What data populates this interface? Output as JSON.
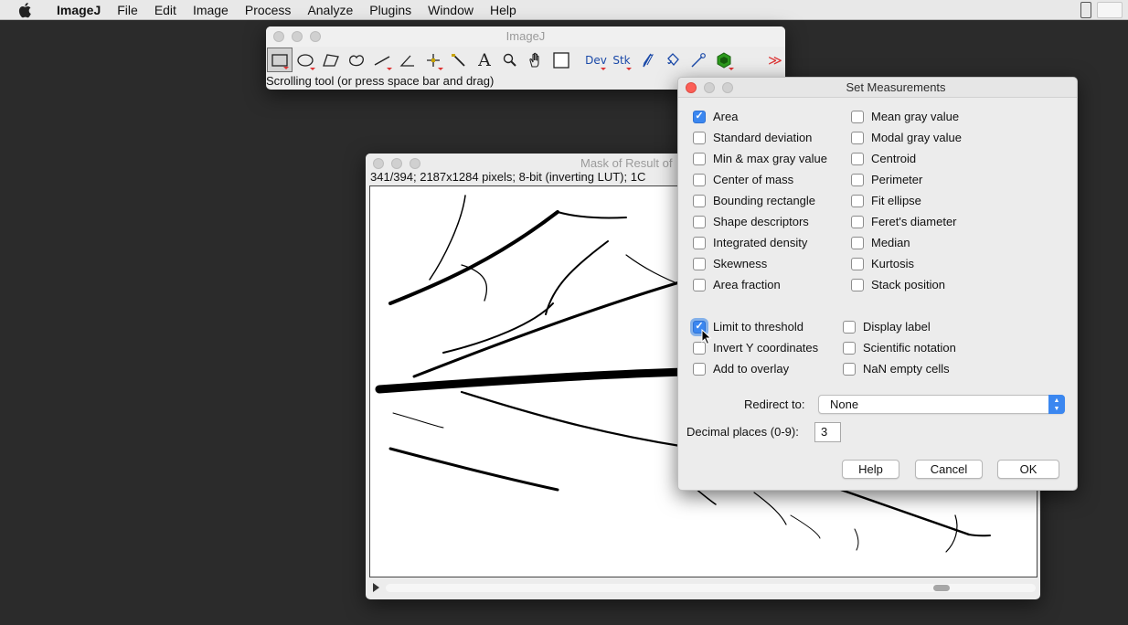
{
  "menubar": {
    "app": "ImageJ",
    "items": [
      "File",
      "Edit",
      "Image",
      "Process",
      "Analyze",
      "Plugins",
      "Window",
      "Help"
    ]
  },
  "imagej_window": {
    "title": "ImageJ",
    "status": "Scrolling tool (or press space bar and drag)",
    "tools": [
      {
        "name": "rectangle-tool-icon",
        "selected": true
      },
      {
        "name": "oval-tool-icon"
      },
      {
        "name": "polygon-tool-icon"
      },
      {
        "name": "freehand-tool-icon"
      },
      {
        "name": "line-tool-icon"
      },
      {
        "name": "angle-tool-icon"
      },
      {
        "name": "point-tool-icon"
      },
      {
        "name": "wand-tool-icon"
      },
      {
        "name": "text-tool-icon",
        "label": "A"
      },
      {
        "name": "magnifier-tool-icon"
      },
      {
        "name": "hand-tool-icon"
      },
      {
        "name": "color-picker-tool-icon"
      },
      {
        "name": "dev-menu",
        "label": "Dev"
      },
      {
        "name": "stk-menu",
        "label": "Stk"
      },
      {
        "name": "brush-tool-icon"
      },
      {
        "name": "flood-fill-tool-icon"
      },
      {
        "name": "pipette-tool-icon"
      },
      {
        "name": "plugin-tool-icon"
      },
      {
        "name": "empty-tool-slot"
      },
      {
        "name": "more-tools-icon",
        "label": "≫"
      }
    ]
  },
  "image_window": {
    "title": "Mask of Result of",
    "info": "341/394; 2187x1284 pixels; 8-bit (inverting LUT); 1C"
  },
  "dialog": {
    "title": "Set Measurements",
    "left_column": [
      {
        "label": "Area",
        "checked": true
      },
      {
        "label": "Standard deviation",
        "checked": false
      },
      {
        "label": "Min & max gray value",
        "checked": false
      },
      {
        "label": "Center of mass",
        "checked": false
      },
      {
        "label": "Bounding rectangle",
        "checked": false
      },
      {
        "label": "Shape descriptors",
        "checked": false
      },
      {
        "label": "Integrated density",
        "checked": false
      },
      {
        "label": "Skewness",
        "checked": false
      },
      {
        "label": "Area fraction",
        "checked": false
      }
    ],
    "right_column": [
      {
        "label": "Mean gray value",
        "checked": false
      },
      {
        "label": "Modal gray value",
        "checked": false
      },
      {
        "label": "Centroid",
        "checked": false
      },
      {
        "label": "Perimeter",
        "checked": false
      },
      {
        "label": "Fit ellipse",
        "checked": false
      },
      {
        "label": "Feret's diameter",
        "checked": false
      },
      {
        "label": "Median",
        "checked": false
      },
      {
        "label": "Kurtosis",
        "checked": false
      },
      {
        "label": "Stack position",
        "checked": false
      }
    ],
    "options_left": [
      {
        "label": "Limit to threshold",
        "checked": true
      },
      {
        "label": "Invert Y coordinates",
        "checked": false
      },
      {
        "label": "Add to overlay",
        "checked": false
      }
    ],
    "options_right": [
      {
        "label": "Display label",
        "checked": false
      },
      {
        "label": "Scientific notation",
        "checked": false
      },
      {
        "label": "NaN empty cells",
        "checked": false
      }
    ],
    "redirect_label": "Redirect to:",
    "redirect_value": "None",
    "decimal_label": "Decimal places (0-9):",
    "decimal_value": "3",
    "buttons": {
      "help": "Help",
      "cancel": "Cancel",
      "ok": "OK"
    }
  }
}
